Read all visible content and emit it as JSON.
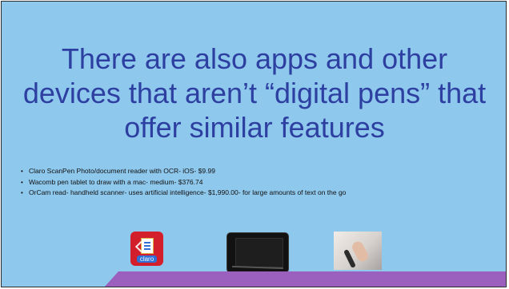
{
  "slide": {
    "title": "There are also apps and other devices that aren’t “digital pens” that offer similar features",
    "bullets": [
      "Claro ScanPen Photo/document reader with OCR- iOS- $9.99",
      "Wacomb pen tablet to draw with a mac- medium- $376.74",
      "OrCam read- handheld scanner- uses artificial intelligence- $1,990.00- for large amounts of text on the go"
    ],
    "images": {
      "claro_logo_text": "claro",
      "stray_mark": "\""
    },
    "colors": {
      "background": "#8fc8ed",
      "title": "#2d3fa0",
      "accent_band": "#9b5fbe",
      "claro_red": "#d21f2b",
      "claro_blue": "#2f6fd6"
    }
  }
}
